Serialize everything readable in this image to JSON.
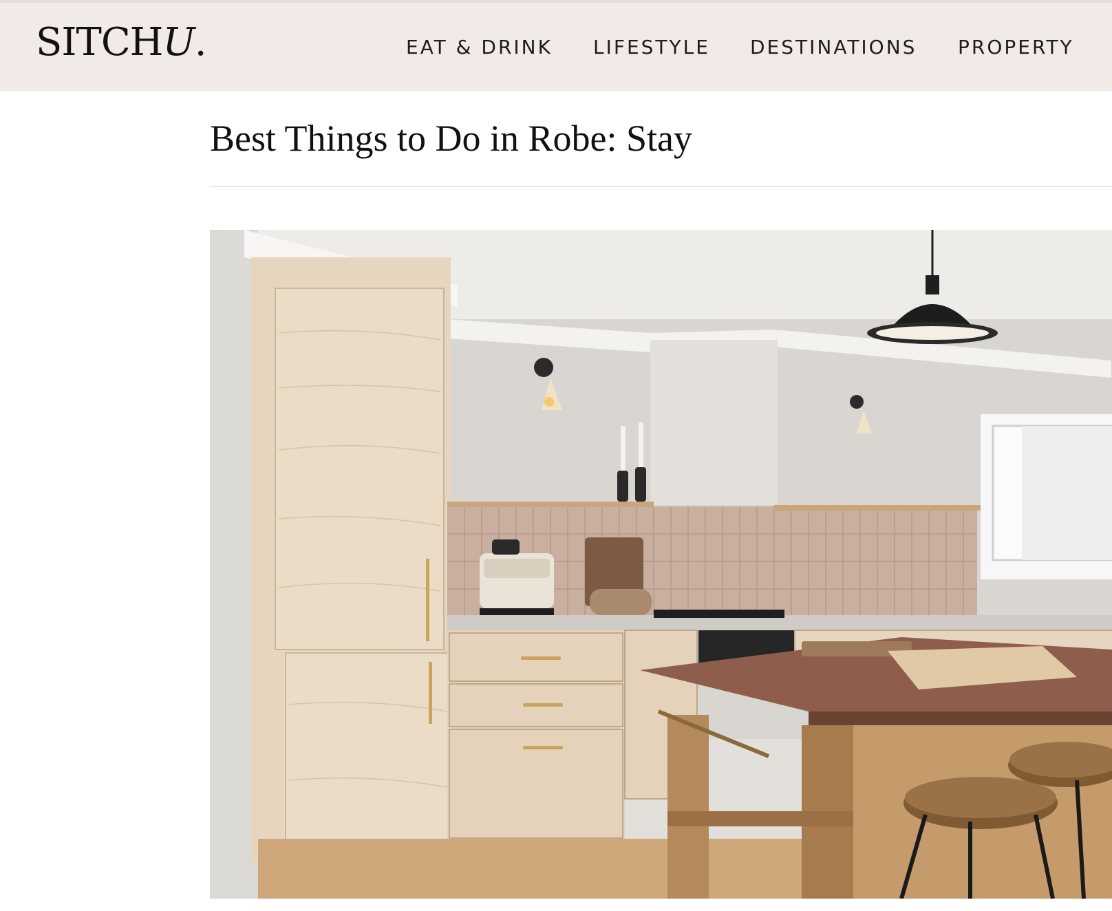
{
  "site": {
    "logo_main": "SITCH",
    "logo_u": "U",
    "logo_dot": "."
  },
  "nav": {
    "items": [
      {
        "label": "EAT & DRINK"
      },
      {
        "label": "LIFESTYLE"
      },
      {
        "label": "DESTINATIONS"
      },
      {
        "label": "PROPERTY"
      }
    ]
  },
  "article": {
    "title": "Best Things to Do in Robe: Stay"
  },
  "colors": {
    "header_bg": "#f2eae6",
    "text": "#111111"
  }
}
